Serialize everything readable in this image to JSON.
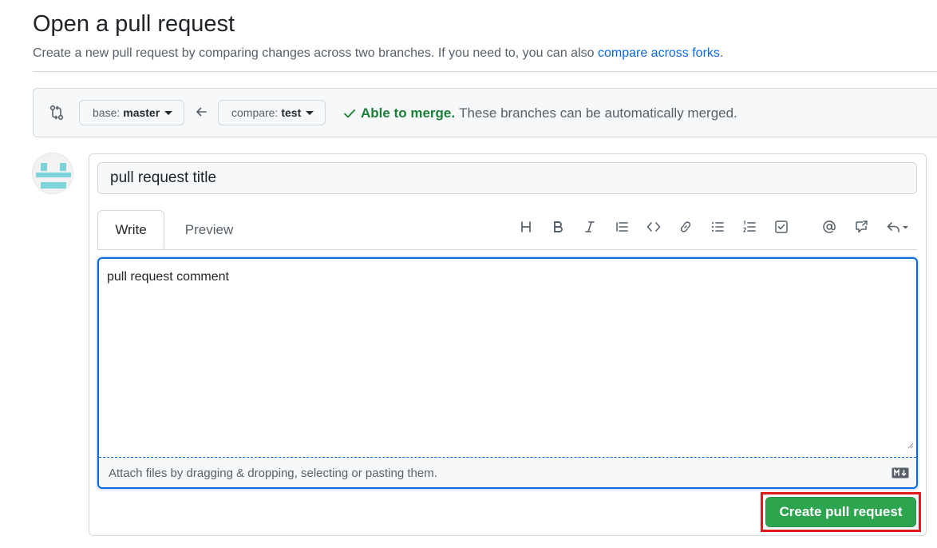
{
  "page": {
    "title": "Open a pull request",
    "subtitle": "Create a new pull request by comparing changes across two branches. If you need to, you can also",
    "subtitle_link": "compare across forks",
    "subtitle_end": "."
  },
  "range": {
    "base_prefix": "base:",
    "base_value": "master",
    "compare_prefix": "compare:",
    "compare_value": "test",
    "merge_ok": "Able to merge.",
    "merge_msg": "These branches can be automatically merged."
  },
  "form": {
    "title_value": "pull request title",
    "tabs": [
      "Write",
      "Preview"
    ],
    "toolbar": [
      "heading-icon",
      "bold-icon",
      "italic-icon",
      "quote-icon",
      "code-icon",
      "link-icon",
      "unordered-list-icon",
      "ordered-list-icon",
      "task-list-icon",
      "mention-icon",
      "cross-reference-icon",
      "saved-replies-icon"
    ],
    "comment_value": "pull request comment",
    "attach_hint": "Attach files by dragging & dropping, selecting or pasting them.",
    "submit_label": "Create pull request"
  },
  "colors": {
    "accent": "#0969da",
    "success": "#2da44e",
    "merge_ok": "#1a7f37",
    "highlight": "#e01a1a"
  }
}
